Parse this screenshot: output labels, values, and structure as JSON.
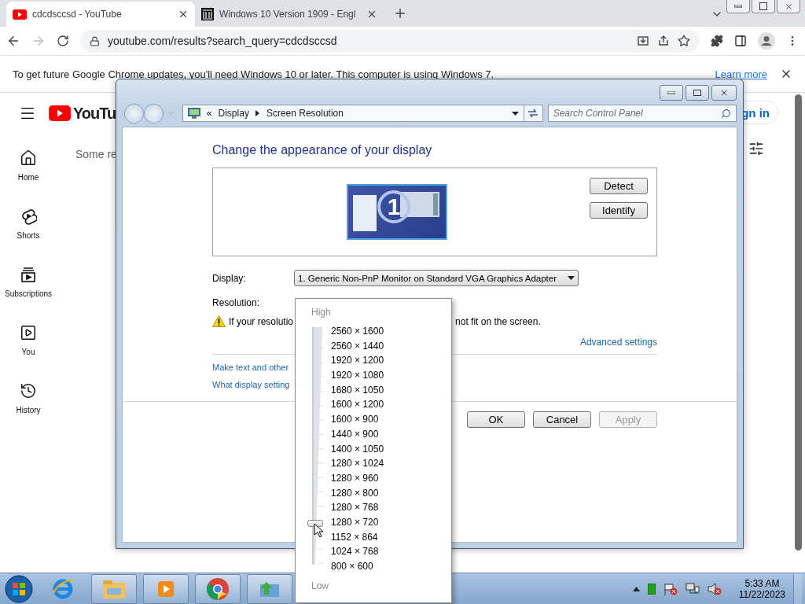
{
  "browser": {
    "tabs": [
      {
        "title": "cdcdsccsd - YouTube",
        "selected": true
      },
      {
        "title": "Windows 10 Version 1909 - Engl",
        "selected": false
      }
    ],
    "address": "youtube.com/results?search_query=cdcdsccsd",
    "infobar": {
      "message": "To get future Google Chrome updates, you'll need Windows 10 or later. This computer is using Windows 7.",
      "link": "Learn more"
    }
  },
  "youtube": {
    "logo": "YouTu",
    "results_text": "Some re",
    "sign_in": "gn in",
    "sidebar": [
      {
        "label": "Home"
      },
      {
        "label": "Shorts"
      },
      {
        "label": "Subscriptions"
      },
      {
        "label": "You"
      },
      {
        "label": "History"
      }
    ]
  },
  "dialog": {
    "overflow_marker": "«",
    "breadcrumb": [
      "Display",
      "Screen Resolution"
    ],
    "search_placeholder": "Search Control Panel",
    "heading": "Change the appearance of your display",
    "monitor_number": "1",
    "side_buttons": [
      "Detect",
      "Identify"
    ],
    "display_label": "Display:",
    "display_value": "1. Generic Non-PnP Monitor on Standard VGA Graphics Adapter",
    "resolution_label": "Resolution:",
    "warning_parts": [
      "If your resolutio",
      "not fit on the screen."
    ],
    "advanced_link": "Advanced settings",
    "links": [
      "Make text and other",
      "What display setting"
    ],
    "footer_buttons": [
      {
        "label": "OK",
        "disabled": false
      },
      {
        "label": "Cancel",
        "disabled": false
      },
      {
        "label": "Apply",
        "disabled": true
      }
    ]
  },
  "resolution_menu": {
    "high": "High",
    "low": "Low",
    "level": 0.1875,
    "options": [
      "2560 × 1600",
      "2560 × 1440",
      "1920 × 1200",
      "1920 × 1080",
      "1680 × 1050",
      "1600 × 1200",
      "1600 × 900",
      "1440 × 900",
      "1400 × 1050",
      "1280 × 1024",
      "1280 × 960",
      "1280 × 800",
      "1280 × 768",
      "1280 × 720",
      "1152 × 864",
      "1024 × 768",
      "800 × 600"
    ]
  },
  "taskbar": {
    "time": "5:33 AM",
    "date": "11/22/2023"
  }
}
